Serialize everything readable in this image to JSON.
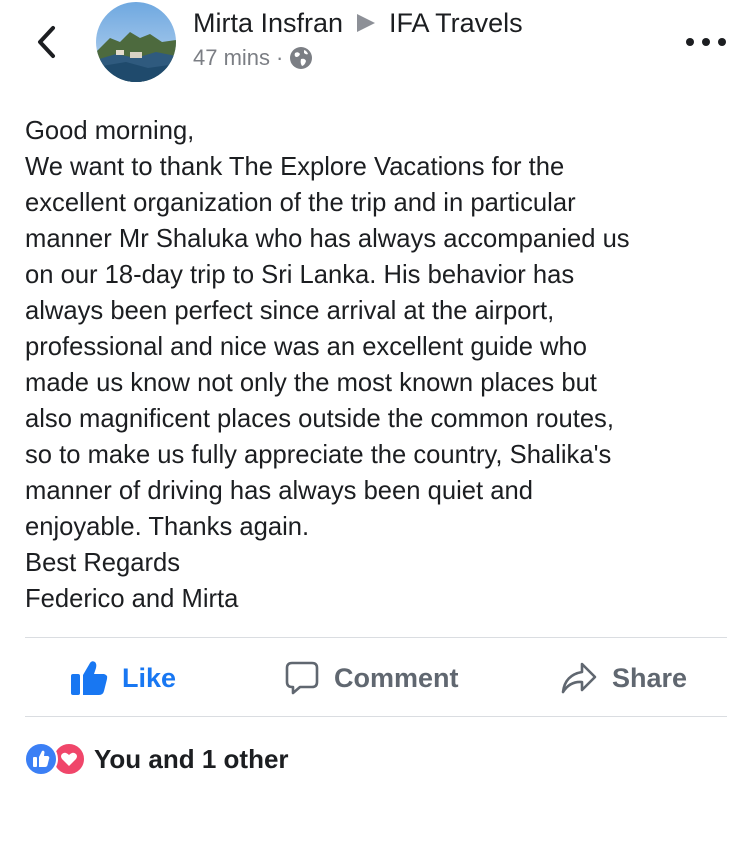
{
  "post": {
    "author": "Mirta Insfran",
    "target": "IFA Travels",
    "time": "47 mins",
    "separator": "·",
    "privacy_icon": "globe-icon",
    "body_lines": [
      "Good morning,",
      "We want to thank The Explore Vacations for the",
      "excellent organization of the trip and in particular",
      "manner Mr Shaluka who has always accompanied us",
      "on our 18-day trip to Sri Lanka. His behavior has",
      "always been perfect since arrival at the airport,",
      "professional and nice was an excellent guide who",
      "made us know not only the most known places but",
      "also magnificent places outside the common routes,",
      "so to make us fully appreciate the country, Shalika's",
      "manner of driving has always been quiet and",
      "enjoyable. Thanks again.",
      "Best Regards",
      "Federico and Mirta"
    ]
  },
  "actions": {
    "like": "Like",
    "comment": "Comment",
    "share": "Share"
  },
  "reactions": {
    "summary": "You and 1 other",
    "icons": [
      "like-reaction-icon",
      "love-reaction-icon"
    ]
  },
  "colors": {
    "accent": "#1877f2",
    "text": "#1c1e21",
    "muted": "#606770",
    "love": "#f0466a"
  }
}
